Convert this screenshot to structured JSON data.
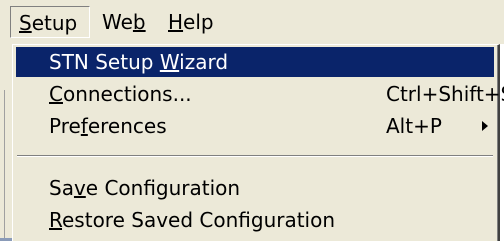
{
  "menubar": {
    "items": [
      {
        "pre": "",
        "key": "S",
        "post": "etup",
        "open": true
      },
      {
        "pre": "We",
        "key": "b",
        "post": "",
        "open": false
      },
      {
        "pre": "",
        "key": "H",
        "post": "elp",
        "open": false
      }
    ]
  },
  "dropdown": {
    "items": [
      {
        "pre": "STN Setup ",
        "key": "W",
        "post": "izard",
        "shortcut": "",
        "highlighted": true
      },
      {
        "pre": "",
        "key": "C",
        "post": "onnections...",
        "shortcut": "Ctrl+Shift+S",
        "highlighted": false
      },
      {
        "pre": "Pre",
        "key": "f",
        "post": "erences",
        "shortcut": "Alt+P",
        "has_submenu": true,
        "highlighted": false
      },
      {
        "pre": "Sa",
        "key": "v",
        "post": "e Configuration",
        "shortcut": "",
        "highlighted": false
      },
      {
        "pre": "",
        "key": "R",
        "post": "estore Saved Configuration",
        "shortcut": "",
        "highlighted": false
      }
    ]
  },
  "colors": {
    "menu_background": "#ece9d8",
    "highlight_background": "#0a246a",
    "highlight_text": "#ffffff"
  }
}
